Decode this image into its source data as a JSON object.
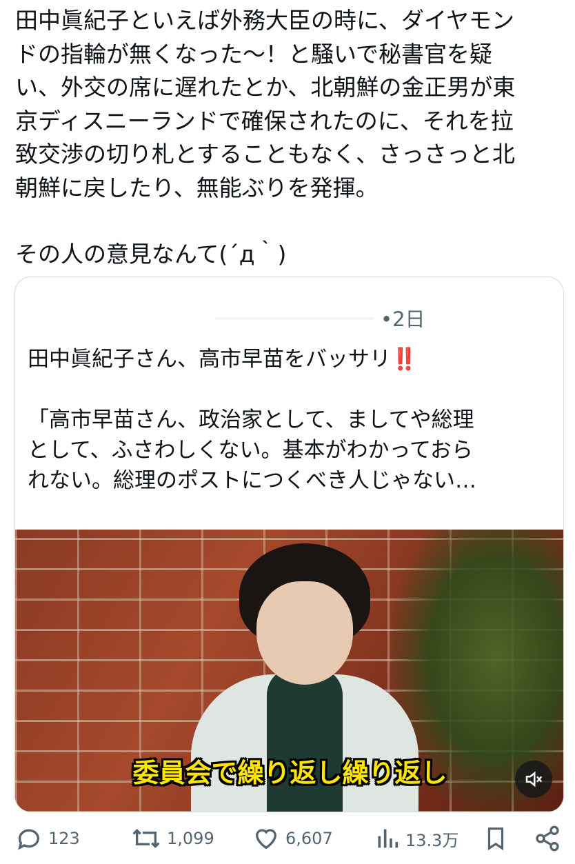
{
  "tweet": {
    "lines": [
      "田中眞紀子といえば外務大臣の時に、ダイヤモン",
      "ドの指輪が無くなった〜！と騒いで秘書官を疑",
      "い、外交の席に遅れたとか、北朝鮮の金正男が東",
      "京ディスニーランドで確保されたのに、それを拉",
      "致交渉の切り札とすることもなく、さっさっと北",
      "朝鮮に戻したり、無能ぶりを発揮。"
    ],
    "line2": "その人の意見なんて(´д｀)"
  },
  "quote": {
    "time": "•2日",
    "headline": "田中眞紀子さん、高市早苗をバッサリ",
    "headline_emoji": "‼️",
    "body_lines": [
      "「高市早苗さん、政治家として、ましてや総理",
      "として、ふさわしくない。基本がわかっておら",
      "れない。総理のポストにつくべき人じゃない…"
    ],
    "video_caption": "委員会で繰り返し繰り返し",
    "mute_icon": "muted-speaker-icon"
  },
  "actions": {
    "replies": "123",
    "reposts": "1,099",
    "likes": "6,607",
    "views": "13.3万"
  },
  "colors": {
    "text": "#0f1419",
    "muted": "#536471",
    "border": "#cfd9de",
    "caption_yellow": "#ffe600"
  }
}
